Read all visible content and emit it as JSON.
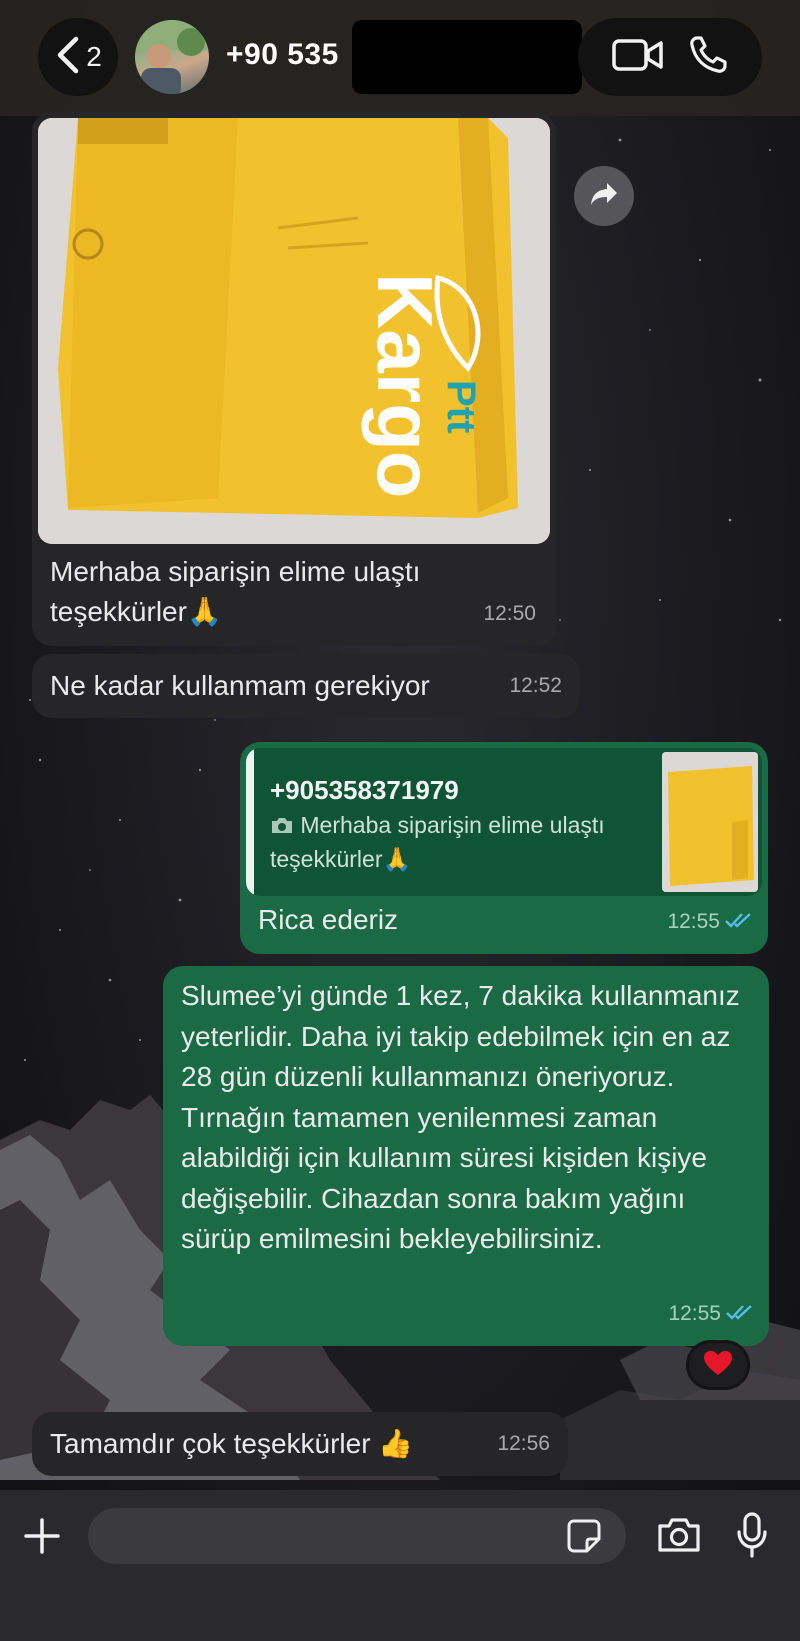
{
  "header": {
    "back_count": "2",
    "contact_title": "+90 535"
  },
  "messages": {
    "image_msg": {
      "caption": "Merhaba siparişin elime ulaştı teşekkürler🙏",
      "time": "12:50",
      "photo_brand_text": "Kargo",
      "photo_logo_text": "Ptt"
    },
    "question": {
      "text": "Ne kadar kullanmam gerekiyor",
      "time": "12:52"
    },
    "reply": {
      "quoted_name": "+905358371979",
      "quoted_text": "Merhaba siparişin elime ulaştı teşekkürler🙏",
      "text": "Rica ederiz",
      "time": "12:55",
      "status": "read"
    },
    "long": {
      "text": "Slumee’yi günde 1 kez, 7 dakika kullanmanız yeterlidir. Daha iyi takip edebilmek için en az 28 gün düzenli kullanmanızı öneriyoruz. Tırnağın tamamen yenilenmesi zaman alabildiği için kullanım süresi kişiden kişiye değişebilir. Cihazdan sonra bakım yağını sürüp emilmesini bekleyebilirsiniz.",
      "time": "12:55",
      "status": "read",
      "reaction": "❤️"
    },
    "last": {
      "text": "Tamamdır çok teşekkürler 👍",
      "time": "12:56"
    }
  },
  "input": {
    "value": "",
    "placeholder": ""
  },
  "colors": {
    "incoming_bubble": "#262628",
    "outgoing_bubble": "#1a6a45",
    "read_ticks": "#53bdeb",
    "ptt_yellow": "#f2c12e"
  },
  "icons": {
    "back": "chevron-left-icon",
    "video": "video-camera-icon",
    "call": "phone-icon",
    "forward": "forward-icon",
    "quote_camera": "camera-icon",
    "plus": "plus-icon",
    "sticker": "sticker-icon",
    "camera": "camera-icon",
    "mic": "microphone-icon"
  }
}
